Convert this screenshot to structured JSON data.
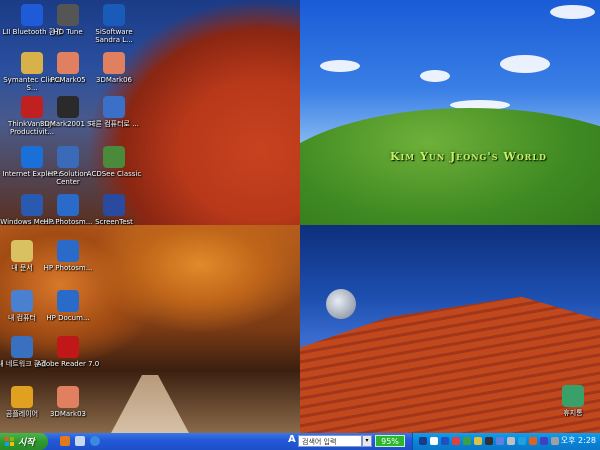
{
  "wallpaper_text": "Kim Yun Jeong's World",
  "desktop_icons": [
    {
      "label": "LII Bluetooth 환경",
      "icon": "bluetooth-icon",
      "color": "#1e5bd6"
    },
    {
      "label": "HD Tune",
      "icon": "hd-tune-icon",
      "color": "#555555"
    },
    {
      "label": "SiSoftware Sandra L...",
      "icon": "sandra-icon",
      "color": "#1a5ab8"
    },
    {
      "label": "Symantec Client S...",
      "icon": "folder-icon",
      "color": "#d9b14a"
    },
    {
      "label": "PCMark05",
      "icon": "pcmark-icon",
      "color": "#e08060"
    },
    {
      "label": "3DMark06",
      "icon": "3dmark-icon",
      "color": "#e08060"
    },
    {
      "label": "ThinkVantage Productivit...",
      "icon": "thinkvantage-icon",
      "color": "#c02020"
    },
    {
      "label": "3DMark2001 SE",
      "icon": "3dmark2001-icon",
      "color": "#2a2a2a"
    },
    {
      "label": "다른 컴퓨터로 ...",
      "icon": "transfer-icon",
      "color": "#3a70c8"
    },
    {
      "label": "Internet Explorer",
      "icon": "ie-icon",
      "color": "#1a70d8"
    },
    {
      "label": "HP Solution Center",
      "icon": "hp-solution-icon",
      "color": "#3a6ab8"
    },
    {
      "label": "ACDSee Classic",
      "icon": "acdsee-icon",
      "color": "#4a8a3a"
    },
    {
      "label": "Windows Media ...",
      "icon": "media-player-icon",
      "color": "#2a5ab0"
    },
    {
      "label": "HP Photosm...",
      "icon": "hp-photosmart-icon",
      "color": "#2a6ac8"
    },
    {
      "label": "ScreenTest",
      "icon": "screentest-icon",
      "color": "#2a4aa0"
    },
    {
      "label": "내 문서",
      "icon": "my-documents-icon",
      "color": "#d9c060"
    },
    {
      "label": "HP Photosm...",
      "icon": "hp-photosmart-icon",
      "color": "#2a6ac8"
    },
    {
      "label": "내 컴퓨터",
      "icon": "my-computer-icon",
      "color": "#4a80d0"
    },
    {
      "label": "HP Docum...",
      "icon": "hp-document-icon",
      "color": "#2a6ac8"
    },
    {
      "label": "내 네트워크 환경",
      "icon": "network-icon",
      "color": "#3a70c0"
    },
    {
      "label": "Adobe Reader 7.0",
      "icon": "adobe-reader-icon",
      "color": "#c01818"
    },
    {
      "label": "곰플레이어",
      "icon": "gom-player-icon",
      "color": "#e0a020"
    },
    {
      "label": "3DMark03",
      "icon": "3dmark03-icon",
      "color": "#e08060"
    },
    {
      "label": "휴지통",
      "icon": "recycle-bin-icon",
      "color": "#3aa06a"
    }
  ],
  "taskbar": {
    "start_label": "시작",
    "search_letter": "A",
    "search_placeholder": "검색어 입력",
    "zoom": "95%",
    "clock": "오후 2:28"
  }
}
